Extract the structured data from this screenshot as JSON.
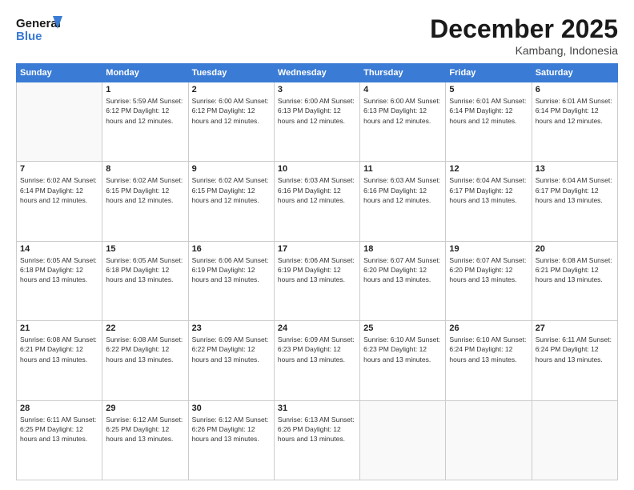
{
  "header": {
    "logo_line1": "General",
    "logo_line2": "Blue",
    "title": "December 2025",
    "location": "Kambang, Indonesia"
  },
  "days_of_week": [
    "Sunday",
    "Monday",
    "Tuesday",
    "Wednesday",
    "Thursday",
    "Friday",
    "Saturday"
  ],
  "weeks": [
    [
      {
        "day": "",
        "info": ""
      },
      {
        "day": "1",
        "info": "Sunrise: 5:59 AM\nSunset: 6:12 PM\nDaylight: 12 hours\nand 12 minutes."
      },
      {
        "day": "2",
        "info": "Sunrise: 6:00 AM\nSunset: 6:12 PM\nDaylight: 12 hours\nand 12 minutes."
      },
      {
        "day": "3",
        "info": "Sunrise: 6:00 AM\nSunset: 6:13 PM\nDaylight: 12 hours\nand 12 minutes."
      },
      {
        "day": "4",
        "info": "Sunrise: 6:00 AM\nSunset: 6:13 PM\nDaylight: 12 hours\nand 12 minutes."
      },
      {
        "day": "5",
        "info": "Sunrise: 6:01 AM\nSunset: 6:14 PM\nDaylight: 12 hours\nand 12 minutes."
      },
      {
        "day": "6",
        "info": "Sunrise: 6:01 AM\nSunset: 6:14 PM\nDaylight: 12 hours\nand 12 minutes."
      }
    ],
    [
      {
        "day": "7",
        "info": "Sunrise: 6:02 AM\nSunset: 6:14 PM\nDaylight: 12 hours\nand 12 minutes."
      },
      {
        "day": "8",
        "info": "Sunrise: 6:02 AM\nSunset: 6:15 PM\nDaylight: 12 hours\nand 12 minutes."
      },
      {
        "day": "9",
        "info": "Sunrise: 6:02 AM\nSunset: 6:15 PM\nDaylight: 12 hours\nand 12 minutes."
      },
      {
        "day": "10",
        "info": "Sunrise: 6:03 AM\nSunset: 6:16 PM\nDaylight: 12 hours\nand 12 minutes."
      },
      {
        "day": "11",
        "info": "Sunrise: 6:03 AM\nSunset: 6:16 PM\nDaylight: 12 hours\nand 12 minutes."
      },
      {
        "day": "12",
        "info": "Sunrise: 6:04 AM\nSunset: 6:17 PM\nDaylight: 12 hours\nand 13 minutes."
      },
      {
        "day": "13",
        "info": "Sunrise: 6:04 AM\nSunset: 6:17 PM\nDaylight: 12 hours\nand 13 minutes."
      }
    ],
    [
      {
        "day": "14",
        "info": "Sunrise: 6:05 AM\nSunset: 6:18 PM\nDaylight: 12 hours\nand 13 minutes."
      },
      {
        "day": "15",
        "info": "Sunrise: 6:05 AM\nSunset: 6:18 PM\nDaylight: 12 hours\nand 13 minutes."
      },
      {
        "day": "16",
        "info": "Sunrise: 6:06 AM\nSunset: 6:19 PM\nDaylight: 12 hours\nand 13 minutes."
      },
      {
        "day": "17",
        "info": "Sunrise: 6:06 AM\nSunset: 6:19 PM\nDaylight: 12 hours\nand 13 minutes."
      },
      {
        "day": "18",
        "info": "Sunrise: 6:07 AM\nSunset: 6:20 PM\nDaylight: 12 hours\nand 13 minutes."
      },
      {
        "day": "19",
        "info": "Sunrise: 6:07 AM\nSunset: 6:20 PM\nDaylight: 12 hours\nand 13 minutes."
      },
      {
        "day": "20",
        "info": "Sunrise: 6:08 AM\nSunset: 6:21 PM\nDaylight: 12 hours\nand 13 minutes."
      }
    ],
    [
      {
        "day": "21",
        "info": "Sunrise: 6:08 AM\nSunset: 6:21 PM\nDaylight: 12 hours\nand 13 minutes."
      },
      {
        "day": "22",
        "info": "Sunrise: 6:08 AM\nSunset: 6:22 PM\nDaylight: 12 hours\nand 13 minutes."
      },
      {
        "day": "23",
        "info": "Sunrise: 6:09 AM\nSunset: 6:22 PM\nDaylight: 12 hours\nand 13 minutes."
      },
      {
        "day": "24",
        "info": "Sunrise: 6:09 AM\nSunset: 6:23 PM\nDaylight: 12 hours\nand 13 minutes."
      },
      {
        "day": "25",
        "info": "Sunrise: 6:10 AM\nSunset: 6:23 PM\nDaylight: 12 hours\nand 13 minutes."
      },
      {
        "day": "26",
        "info": "Sunrise: 6:10 AM\nSunset: 6:24 PM\nDaylight: 12 hours\nand 13 minutes."
      },
      {
        "day": "27",
        "info": "Sunrise: 6:11 AM\nSunset: 6:24 PM\nDaylight: 12 hours\nand 13 minutes."
      }
    ],
    [
      {
        "day": "28",
        "info": "Sunrise: 6:11 AM\nSunset: 6:25 PM\nDaylight: 12 hours\nand 13 minutes."
      },
      {
        "day": "29",
        "info": "Sunrise: 6:12 AM\nSunset: 6:25 PM\nDaylight: 12 hours\nand 13 minutes."
      },
      {
        "day": "30",
        "info": "Sunrise: 6:12 AM\nSunset: 6:26 PM\nDaylight: 12 hours\nand 13 minutes."
      },
      {
        "day": "31",
        "info": "Sunrise: 6:13 AM\nSunset: 6:26 PM\nDaylight: 12 hours\nand 13 minutes."
      },
      {
        "day": "",
        "info": ""
      },
      {
        "day": "",
        "info": ""
      },
      {
        "day": "",
        "info": ""
      }
    ]
  ]
}
